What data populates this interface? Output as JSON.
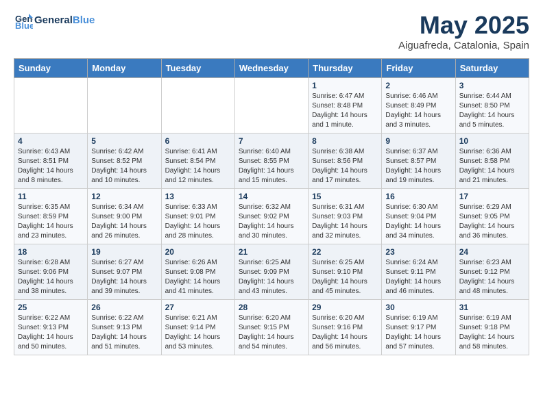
{
  "header": {
    "logo_line1": "General",
    "logo_line2": "Blue",
    "month_title": "May 2025",
    "location": "Aiguafreda, Catalonia, Spain"
  },
  "days_of_week": [
    "Sunday",
    "Monday",
    "Tuesday",
    "Wednesday",
    "Thursday",
    "Friday",
    "Saturday"
  ],
  "weeks": [
    [
      {
        "day": "",
        "info": ""
      },
      {
        "day": "",
        "info": ""
      },
      {
        "day": "",
        "info": ""
      },
      {
        "day": "",
        "info": ""
      },
      {
        "day": "1",
        "info": "Sunrise: 6:47 AM\nSunset: 8:48 PM\nDaylight: 14 hours and 1 minute."
      },
      {
        "day": "2",
        "info": "Sunrise: 6:46 AM\nSunset: 8:49 PM\nDaylight: 14 hours and 3 minutes."
      },
      {
        "day": "3",
        "info": "Sunrise: 6:44 AM\nSunset: 8:50 PM\nDaylight: 14 hours and 5 minutes."
      }
    ],
    [
      {
        "day": "4",
        "info": "Sunrise: 6:43 AM\nSunset: 8:51 PM\nDaylight: 14 hours and 8 minutes."
      },
      {
        "day": "5",
        "info": "Sunrise: 6:42 AM\nSunset: 8:52 PM\nDaylight: 14 hours and 10 minutes."
      },
      {
        "day": "6",
        "info": "Sunrise: 6:41 AM\nSunset: 8:54 PM\nDaylight: 14 hours and 12 minutes."
      },
      {
        "day": "7",
        "info": "Sunrise: 6:40 AM\nSunset: 8:55 PM\nDaylight: 14 hours and 15 minutes."
      },
      {
        "day": "8",
        "info": "Sunrise: 6:38 AM\nSunset: 8:56 PM\nDaylight: 14 hours and 17 minutes."
      },
      {
        "day": "9",
        "info": "Sunrise: 6:37 AM\nSunset: 8:57 PM\nDaylight: 14 hours and 19 minutes."
      },
      {
        "day": "10",
        "info": "Sunrise: 6:36 AM\nSunset: 8:58 PM\nDaylight: 14 hours and 21 minutes."
      }
    ],
    [
      {
        "day": "11",
        "info": "Sunrise: 6:35 AM\nSunset: 8:59 PM\nDaylight: 14 hours and 23 minutes."
      },
      {
        "day": "12",
        "info": "Sunrise: 6:34 AM\nSunset: 9:00 PM\nDaylight: 14 hours and 26 minutes."
      },
      {
        "day": "13",
        "info": "Sunrise: 6:33 AM\nSunset: 9:01 PM\nDaylight: 14 hours and 28 minutes."
      },
      {
        "day": "14",
        "info": "Sunrise: 6:32 AM\nSunset: 9:02 PM\nDaylight: 14 hours and 30 minutes."
      },
      {
        "day": "15",
        "info": "Sunrise: 6:31 AM\nSunset: 9:03 PM\nDaylight: 14 hours and 32 minutes."
      },
      {
        "day": "16",
        "info": "Sunrise: 6:30 AM\nSunset: 9:04 PM\nDaylight: 14 hours and 34 minutes."
      },
      {
        "day": "17",
        "info": "Sunrise: 6:29 AM\nSunset: 9:05 PM\nDaylight: 14 hours and 36 minutes."
      }
    ],
    [
      {
        "day": "18",
        "info": "Sunrise: 6:28 AM\nSunset: 9:06 PM\nDaylight: 14 hours and 38 minutes."
      },
      {
        "day": "19",
        "info": "Sunrise: 6:27 AM\nSunset: 9:07 PM\nDaylight: 14 hours and 39 minutes."
      },
      {
        "day": "20",
        "info": "Sunrise: 6:26 AM\nSunset: 9:08 PM\nDaylight: 14 hours and 41 minutes."
      },
      {
        "day": "21",
        "info": "Sunrise: 6:25 AM\nSunset: 9:09 PM\nDaylight: 14 hours and 43 minutes."
      },
      {
        "day": "22",
        "info": "Sunrise: 6:25 AM\nSunset: 9:10 PM\nDaylight: 14 hours and 45 minutes."
      },
      {
        "day": "23",
        "info": "Sunrise: 6:24 AM\nSunset: 9:11 PM\nDaylight: 14 hours and 46 minutes."
      },
      {
        "day": "24",
        "info": "Sunrise: 6:23 AM\nSunset: 9:12 PM\nDaylight: 14 hours and 48 minutes."
      }
    ],
    [
      {
        "day": "25",
        "info": "Sunrise: 6:22 AM\nSunset: 9:13 PM\nDaylight: 14 hours and 50 minutes."
      },
      {
        "day": "26",
        "info": "Sunrise: 6:22 AM\nSunset: 9:13 PM\nDaylight: 14 hours and 51 minutes."
      },
      {
        "day": "27",
        "info": "Sunrise: 6:21 AM\nSunset: 9:14 PM\nDaylight: 14 hours and 53 minutes."
      },
      {
        "day": "28",
        "info": "Sunrise: 6:20 AM\nSunset: 9:15 PM\nDaylight: 14 hours and 54 minutes."
      },
      {
        "day": "29",
        "info": "Sunrise: 6:20 AM\nSunset: 9:16 PM\nDaylight: 14 hours and 56 minutes."
      },
      {
        "day": "30",
        "info": "Sunrise: 6:19 AM\nSunset: 9:17 PM\nDaylight: 14 hours and 57 minutes."
      },
      {
        "day": "31",
        "info": "Sunrise: 6:19 AM\nSunset: 9:18 PM\nDaylight: 14 hours and 58 minutes."
      }
    ]
  ]
}
